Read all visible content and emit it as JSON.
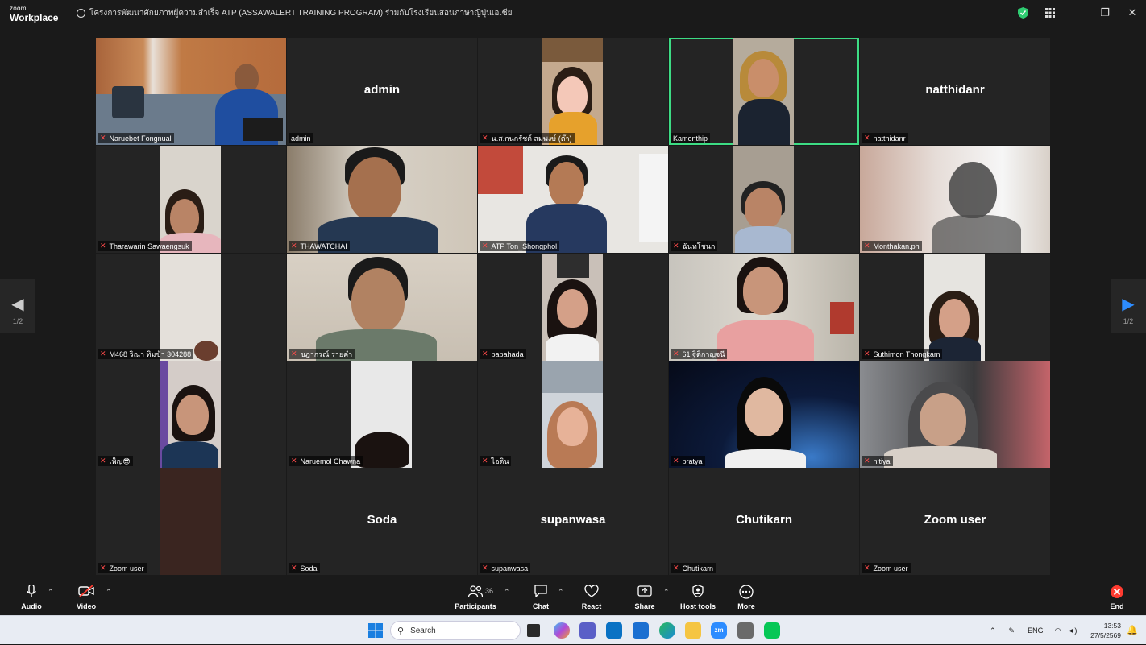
{
  "app": {
    "logo_line1": "zoom",
    "logo_line2": "Workplace",
    "meeting_title": "โครงการพัฒนาศักยภาพผู้ความสำเร็จ ATP (ASSAWALERT TRAINING PROGRAM) ร่วมกับโรงเรียนสอนภาษาญี่ปุ่นเอเซีย"
  },
  "colors": {
    "accent_active": "#3ddc84",
    "mute_red": "#ff4b4b",
    "end_red": "#ff3b30"
  },
  "participants": [
    {
      "name": "Naruebet Fongnual",
      "video": true
    },
    {
      "name": "admin",
      "video": false,
      "big": "admin"
    },
    {
      "name": "น.ส.กนกรัชต์ สมพงษ์ (ต๊า)",
      "video": true
    },
    {
      "name": "Kamonthip",
      "video": true,
      "active": true
    },
    {
      "name": "natthidanr",
      "video": false,
      "big": "natthidanr"
    },
    {
      "name": "Tharawarin Sawaengsuk",
      "video": true
    },
    {
      "name": "THAWATCHAI",
      "video": true
    },
    {
      "name": "ATP Ton_Shongphol",
      "video": true
    },
    {
      "name": "ฉันทโชนก",
      "video": true
    },
    {
      "name": "Monthakan.ph",
      "video": true
    },
    {
      "name": "M468 วิณา ทิมข้า 304288",
      "video": true
    },
    {
      "name": "ขฎากรณ์ รายคำ",
      "video": true
    },
    {
      "name": "papahada",
      "video": true
    },
    {
      "name": "61 ฐิติกาญจนี",
      "video": true
    },
    {
      "name": "Suthimon Thongkam",
      "video": true
    },
    {
      "name": "เพ็ญ😎",
      "video": true
    },
    {
      "name": "Naruemol Chawna",
      "video": true
    },
    {
      "name": "ไอดิน",
      "video": true
    },
    {
      "name": "pratya",
      "video": true
    },
    {
      "name": "nitiya",
      "video": true
    },
    {
      "name": "Zoom user",
      "video": true
    },
    {
      "name": "Soda",
      "video": false,
      "big": "Soda"
    },
    {
      "name": "supanwasa",
      "video": false,
      "big": "supanwasa"
    },
    {
      "name": "Chutikarn",
      "video": false,
      "big": "Chutikarn"
    },
    {
      "name": "Zoom user",
      "video": false,
      "big": "Zoom user"
    }
  ],
  "pager": {
    "left_page": "1/2",
    "right_page": "1/2"
  },
  "toolbar": {
    "audio": "Audio",
    "video": "Video",
    "participants": "Participants",
    "participants_count": "36",
    "chat": "Chat",
    "react": "React",
    "share": "Share",
    "host_tools": "Host tools",
    "more": "More",
    "end": "End"
  },
  "taskbar": {
    "search_placeholder": "Search",
    "lang": "ENG",
    "time": "13:53",
    "date": "27/5/2569"
  }
}
